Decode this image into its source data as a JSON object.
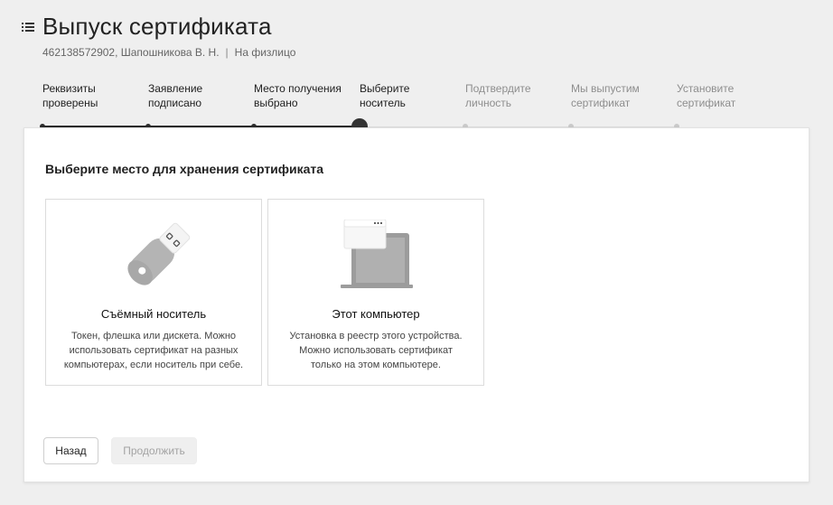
{
  "header": {
    "title": "Выпуск сертификата",
    "subtitle_id_name": "462138572902, Шапошникова В. Н.",
    "subtitle_sep": "|",
    "subtitle_type": "На физлицо"
  },
  "steps": [
    {
      "line1": "Реквизиты",
      "line2": "проверены",
      "state": "done"
    },
    {
      "line1": "Заявление",
      "line2": "подписано",
      "state": "done"
    },
    {
      "line1": "Место получения",
      "line2": "выбрано",
      "state": "done"
    },
    {
      "line1": "Выберите",
      "line2": "носитель",
      "state": "current"
    },
    {
      "line1": "Подтвердите",
      "line2": "личность",
      "state": "future"
    },
    {
      "line1": "Мы выпустим",
      "line2": "сертификат",
      "state": "future"
    },
    {
      "line1": "Установите",
      "line2": "сертификат",
      "state": "future"
    }
  ],
  "panel": {
    "heading": "Выберите место для хранения сертификата",
    "options": [
      {
        "icon": "usb-drive-icon",
        "title": "Съёмный носитель",
        "desc_line1": "Токен, флешка или дискета. Можно",
        "desc_line2": "использовать сертификат на разных",
        "desc_line3": "компьютерах, если носитель при себе."
      },
      {
        "icon": "laptop-icon",
        "title": "Этот компьютер",
        "desc_line1": "Установка в реестр этого устройства.",
        "desc_line2": "Можно использовать сертификат",
        "desc_line3": "только на этом компьютере."
      }
    ]
  },
  "buttons": {
    "back": "Назад",
    "continue": "Продолжить"
  },
  "colors": {
    "background": "#efefef",
    "panel": "#ffffff",
    "step_done": "#2b2b2b",
    "step_future": "#c9c9c9",
    "disabled_text": "#a3a3a3"
  }
}
